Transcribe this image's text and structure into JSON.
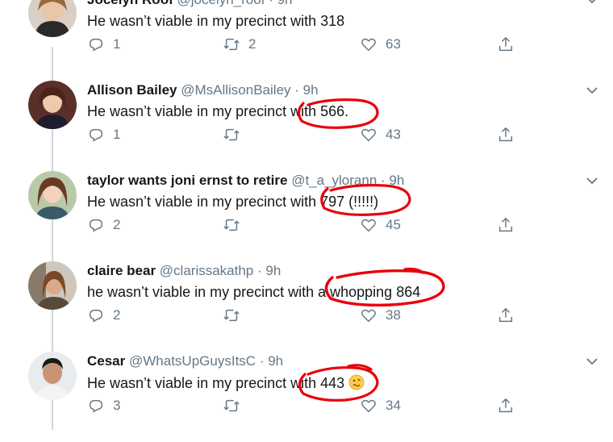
{
  "tweets": [
    {
      "name": "Jocelyn Roof",
      "handle": "@jocelyn_roof",
      "time": "9h",
      "text": "He wasn’t viable in my precinct with 318",
      "replies": "1",
      "retweets": "2",
      "likes": "63"
    },
    {
      "name": "Allison Bailey",
      "handle": "@MsAllisonBailey",
      "time": "9h",
      "text": "He wasn’t viable in my precinct with 566.",
      "replies": "1",
      "retweets": "",
      "likes": "43"
    },
    {
      "name": "taylor wants joni ernst to retire",
      "handle": "@t_a_ylorann",
      "time": "9h",
      "text": "He wasn’t viable in my precinct with 797 (!!!!!)",
      "replies": "2",
      "retweets": "",
      "likes": "45"
    },
    {
      "name": "claire bear",
      "handle": "@clarissakathp",
      "time": "9h",
      "text": "he wasn’t viable in my precinct with a whopping 864",
      "replies": "2",
      "retweets": "",
      "likes": "38"
    },
    {
      "name": "Cesar",
      "handle": "@WhatsUpGuysItsC",
      "time": "9h",
      "text": "He wasn’t viable in my precinct with 443",
      "replies": "3",
      "retweets": "",
      "likes": "34"
    }
  ],
  "separator": "·",
  "icons": {
    "reply": "reply-icon",
    "retweet": "retweet-icon",
    "like": "heart-icon",
    "share": "share-icon",
    "menu": "chevron-down-icon",
    "emoji": "woozy-face-emoji"
  },
  "colors": {
    "annotation_red": "#e8000b",
    "muted": "#657786",
    "thread_line": "#ccd6dd"
  }
}
